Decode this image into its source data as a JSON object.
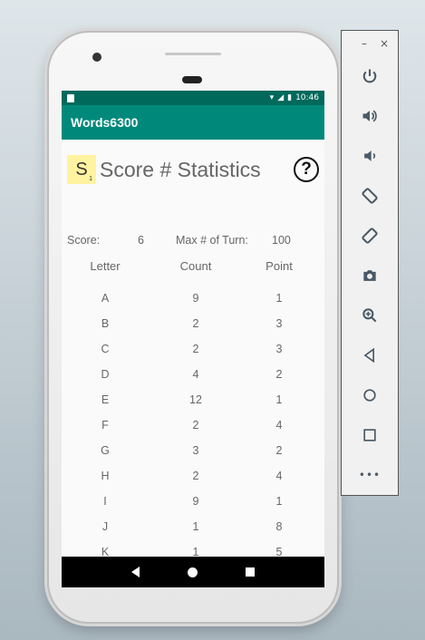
{
  "app": {
    "title": "Words6300",
    "status_time": "10:46"
  },
  "stats": {
    "tile_letter": "S",
    "tile_subscript": "1",
    "title": "Score # Statistics",
    "help_icon": "?",
    "score_label": "Score:",
    "score_value": "6",
    "max_turn_label": "Max # of Turn:",
    "max_turn_value": "100",
    "columns": [
      "Letter",
      "Count",
      "Point"
    ],
    "rows": [
      [
        "A",
        "9",
        "1"
      ],
      [
        "B",
        "2",
        "3"
      ],
      [
        "C",
        "2",
        "3"
      ],
      [
        "D",
        "4",
        "2"
      ],
      [
        "E",
        "12",
        "1"
      ],
      [
        "F",
        "2",
        "4"
      ],
      [
        "G",
        "3",
        "2"
      ],
      [
        "H",
        "2",
        "4"
      ],
      [
        "I",
        "9",
        "1"
      ],
      [
        "J",
        "1",
        "8"
      ],
      [
        "K",
        "1",
        "5"
      ]
    ]
  },
  "panel": {
    "minimize": "–",
    "close": "×",
    "more": "•••",
    "buttons": [
      "power-icon",
      "volume-up-icon",
      "volume-down-icon",
      "rotate-left-icon",
      "rotate-right-icon",
      "camera-icon",
      "zoom-icon",
      "back-icon",
      "home-icon",
      "overview-icon",
      "more-icon"
    ]
  }
}
